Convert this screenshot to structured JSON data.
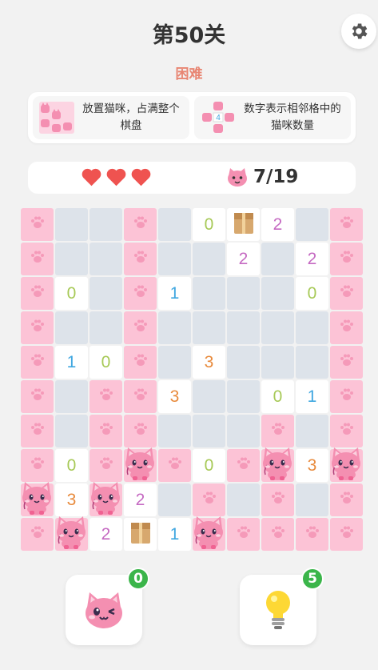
{
  "header": {
    "title": "第50关",
    "difficulty": "困难"
  },
  "rules": [
    {
      "text": "放置猫咪，占满整个棋盘",
      "icon": "pink-cats-grid-icon"
    },
    {
      "text": "数字表示相邻格中的猫咪数量",
      "icon": "number-hint-icon",
      "sample_number": "4"
    }
  ],
  "status": {
    "lives": 3,
    "cat_counter": "7/19"
  },
  "colors": {
    "pink_cell": "#fcc3d6",
    "empty_cell": "#dde3ea",
    "paw": "#f59ab9",
    "cat": "#f48fb1",
    "badge": "#3bb54a",
    "difficulty": "#e88572"
  },
  "board": {
    "rows": [
      [
        "P",
        "E",
        "E",
        "P",
        "E",
        "N0",
        "B",
        "N2",
        "E",
        "P"
      ],
      [
        "P",
        "E",
        "E",
        "P",
        "E",
        "E",
        "N2",
        "E",
        "N2",
        "P"
      ],
      [
        "P",
        "N0",
        "E",
        "P",
        "N1",
        "E",
        "E",
        "E",
        "N0",
        "P"
      ],
      [
        "P",
        "E",
        "E",
        "P",
        "E",
        "E",
        "E",
        "E",
        "E",
        "P"
      ],
      [
        "P",
        "N1",
        "N0",
        "P",
        "E",
        "N3",
        "E",
        "E",
        "E",
        "P"
      ],
      [
        "P",
        "E",
        "P",
        "P",
        "N3",
        "E",
        "E",
        "N0",
        "N1",
        "P"
      ],
      [
        "P",
        "E",
        "P",
        "P",
        "E",
        "E",
        "E",
        "P",
        "E",
        "P"
      ],
      [
        "P",
        "N0",
        "P",
        "C",
        "P",
        "N0",
        "P",
        "C",
        "N3",
        "C"
      ],
      [
        "C",
        "N3",
        "C",
        "N2",
        "E",
        "P",
        "E",
        "P",
        "E",
        "P"
      ],
      [
        "P",
        "C",
        "N2",
        "B",
        "N1",
        "C",
        "P",
        "P",
        "P",
        "P"
      ]
    ],
    "number_colors": {
      "0": "#a7c957",
      "1": "#3fa7e0",
      "2": "#c56ac2",
      "3": "#e88a3c"
    }
  },
  "actions": [
    {
      "name": "place-cat-button",
      "icon": "winking-cat-icon",
      "badge": "0"
    },
    {
      "name": "hint-button",
      "icon": "lightbulb-icon",
      "badge": "5"
    }
  ]
}
